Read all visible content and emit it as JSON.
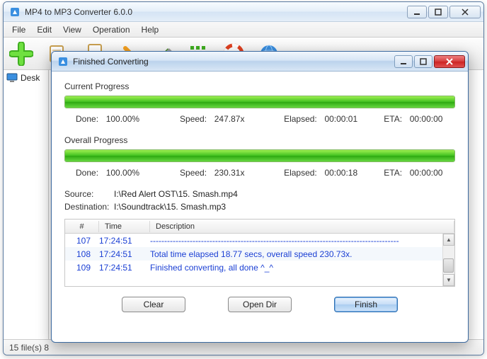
{
  "main": {
    "title": "MP4 to MP3 Converter 6.0.0",
    "menu": [
      "File",
      "Edit",
      "View",
      "Operation",
      "Help"
    ],
    "sidebar_item": "Desk",
    "status": "15 file(s)   8"
  },
  "dialog": {
    "title": "Finished Converting",
    "current": {
      "label": "Current Progress",
      "done_lbl": "Done:",
      "done": "100.00%",
      "speed_lbl": "Speed:",
      "speed": "247.87x",
      "elapsed_lbl": "Elapsed:",
      "elapsed": "00:00:01",
      "eta_lbl": "ETA:",
      "eta": "00:00:00",
      "percent": 100
    },
    "overall": {
      "label": "Overall Progress",
      "done_lbl": "Done:",
      "done": "100.00%",
      "speed_lbl": "Speed:",
      "speed": "230.31x",
      "elapsed_lbl": "Elapsed:",
      "elapsed": "00:00:18",
      "eta_lbl": "ETA:",
      "eta": "00:00:00",
      "percent": 100
    },
    "source_lbl": "Source:",
    "source": "I:\\Red Alert OST\\15. Smash.mp4",
    "dest_lbl": "Destination:",
    "dest": "I:\\Soundtrack\\15. Smash.mp3",
    "log_headers": {
      "n": "#",
      "time": "Time",
      "desc": "Description"
    },
    "log": [
      {
        "n": "107",
        "t": "17:24:51",
        "d": "----------------------------------------------------------------------------------------"
      },
      {
        "n": "108",
        "t": "17:24:51",
        "d": "Total time elapsed 18.77 secs, overall speed 230.73x."
      },
      {
        "n": "109",
        "t": "17:24:51",
        "d": "Finished converting, all done ^_^"
      }
    ],
    "buttons": {
      "clear": "Clear",
      "open_dir": "Open Dir",
      "finish": "Finish"
    }
  }
}
